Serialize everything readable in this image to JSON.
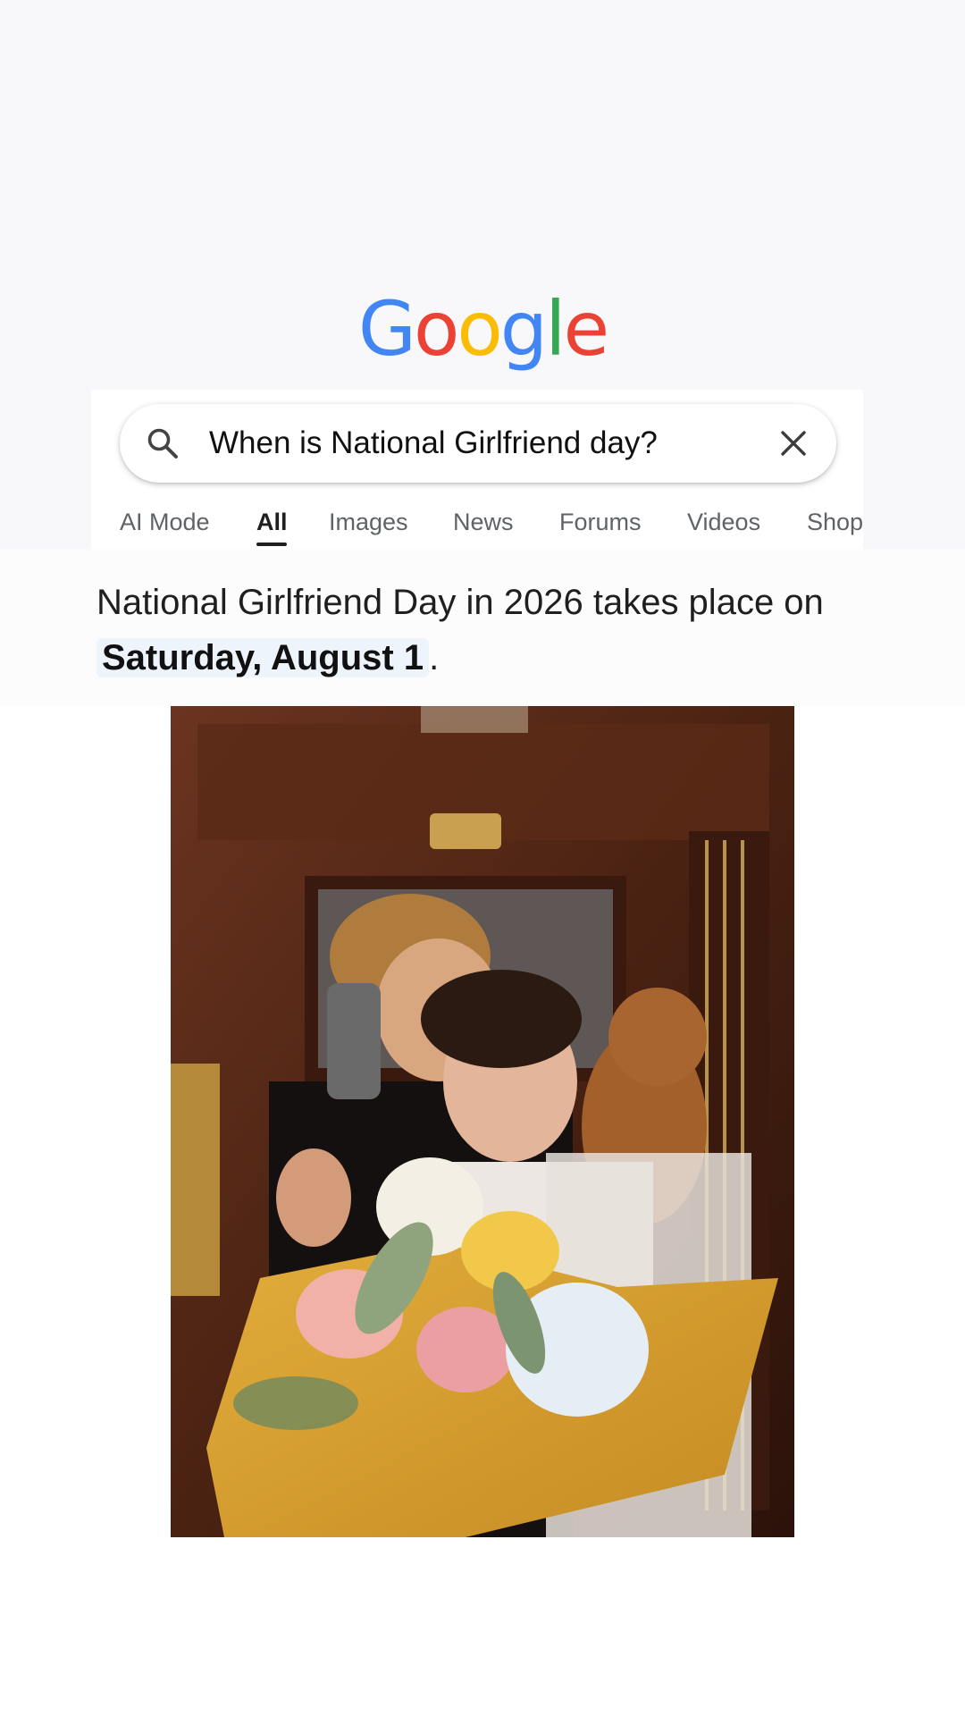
{
  "logo": {
    "letters": [
      "G",
      "o",
      "o",
      "g",
      "l",
      "e"
    ],
    "colors": [
      "#4285F4",
      "#EA4335",
      "#FBBC05",
      "#4285F4",
      "#34A853",
      "#EA4335"
    ]
  },
  "search": {
    "query": "When is National Girlfriend day?",
    "icon": "search-icon",
    "clear_icon": "close-icon"
  },
  "tabs": [
    {
      "label": "AI Mode",
      "active": false
    },
    {
      "label": "All",
      "active": true
    },
    {
      "label": "Images",
      "active": false
    },
    {
      "label": "News",
      "active": false
    },
    {
      "label": "Forums",
      "active": false
    },
    {
      "label": "Videos",
      "active": false
    },
    {
      "label": "Shop",
      "active": false
    }
  ],
  "answer": {
    "line1": "National Girlfriend Day in 2026 takes place on",
    "highlight": "Saturday, August 1",
    "suffix": "."
  },
  "colors": {
    "accent_text": "#1f1f1f",
    "tab_inactive": "#5f6368",
    "highlight_bg": "#eef4fc"
  }
}
